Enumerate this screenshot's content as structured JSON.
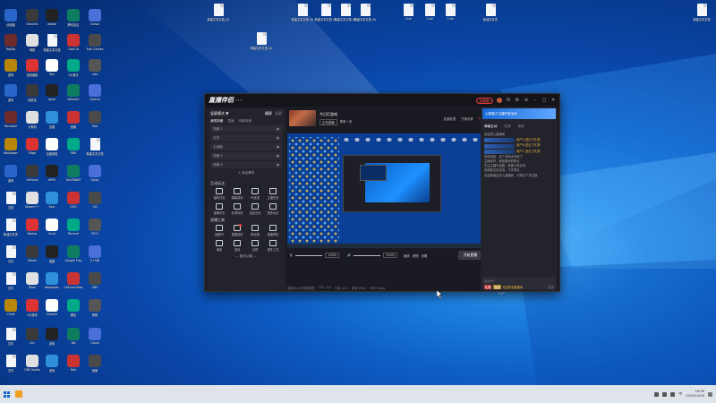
{
  "desktop": {
    "top_files": [
      {
        "label": "新建文本文档 (2)"
      },
      {
        "label": "新建文本文档 (4)"
      },
      {
        "label": "新建文本文档 (3)"
      },
      {
        "label": "新建文本文档 (6)"
      },
      {
        "label": "新建文本文档 (5)"
      },
      {
        "label": "1.txt"
      },
      {
        "label": "1.txt"
      },
      {
        "label": "1.txt"
      },
      {
        "label": "新建文件夹"
      },
      {
        "label": "新建文本文档"
      },
      {
        "label": "新建文本文档 (4)"
      }
    ],
    "left_icons": [
      {
        "label": "此电脑"
      },
      {
        "label": "Genshin"
      },
      {
        "label": "Adobe"
      },
      {
        "label": "腾讯会议"
      },
      {
        "label": "Cursor"
      },
      {
        "label": "TapTap"
      },
      {
        "label": "网络"
      },
      {
        "label": "新建文本文档"
      },
      {
        "label": "CapCut"
      },
      {
        "label": "Epic Games"
      },
      {
        "label": "游戏"
      },
      {
        "label": "控制面板"
      },
      {
        "label": "Key"
      },
      {
        "label": "QQ音乐"
      },
      {
        "label": "Lala"
      },
      {
        "label": "游戏"
      },
      {
        "label": "回收站"
      },
      {
        "label": "Apex"
      },
      {
        "label": "Valorant"
      },
      {
        "label": "Garena"
      },
      {
        "label": "Rockstar"
      },
      {
        "label": "计算机"
      },
      {
        "label": "迅雷"
      },
      {
        "label": "音频"
      },
      {
        "label": "Star"
      },
      {
        "label": "Wallpaper"
      },
      {
        "label": "Edge"
      },
      {
        "label": "百度网盘"
      },
      {
        "label": "OBS"
      },
      {
        "label": "新建文本文档"
      },
      {
        "label": "游戏"
      },
      {
        "label": "GeForce"
      },
      {
        "label": "APEX"
      },
      {
        "label": "VALORANT"
      },
      {
        "label": "Uplay"
      },
      {
        "label": "文档"
      },
      {
        "label": "Steam++"
      },
      {
        "label": "Epic"
      },
      {
        "label": "GOG"
      },
      {
        "label": "QQ"
      },
      {
        "label": "新建文件夹"
      },
      {
        "label": "Norton"
      },
      {
        "label": "Hunt"
      },
      {
        "label": "Tencent"
      },
      {
        "label": "PICO"
      },
      {
        "label": "文件"
      },
      {
        "label": "Steam"
      },
      {
        "label": "猫猫"
      },
      {
        "label": "Google Play"
      },
      {
        "label": "G HUB"
      },
      {
        "label": "文件"
      },
      {
        "label": "Xbox"
      },
      {
        "label": "Wallpaper"
      },
      {
        "label": "GeForce Now"
      },
      {
        "label": "OBS"
      },
      {
        "label": "Circle"
      },
      {
        "label": "QQ游戏"
      },
      {
        "label": "Chrome"
      },
      {
        "label": "微信"
      },
      {
        "label": "狗狗"
      },
      {
        "label": "文件"
      },
      {
        "label": "Arc"
      },
      {
        "label": "游戏"
      },
      {
        "label": "Bili"
      },
      {
        "label": "Cloud"
      },
      {
        "label": "文件"
      },
      {
        "label": "OBS Studio"
      },
      {
        "label": "游戏"
      },
      {
        "label": "Mail"
      },
      {
        "label": "相册"
      },
      {
        "label": "Flash"
      }
    ]
  },
  "app": {
    "logo": "直播伴侣",
    "version": "v7.x",
    "headline_pill": "去获取",
    "left_panel": {
      "mode_label": "竖屏模式 ▼",
      "mode_tags": [
        "横屏",
        "竖屏"
      ],
      "tabs": [
        "我的场景",
        "直播",
        "有趣场景"
      ],
      "scenes": [
        "场景 1",
        "文字",
        "主画面",
        "场景 4",
        "场景 5"
      ],
      "add_source": "+ 添加素材",
      "sections": [
        {
          "title": "互动玩法",
          "tools": [
            "福利红包",
            "弹幕游戏",
            "PK连麦",
            "主播任务",
            "直播时长",
            "礼物特效",
            "连麦互动",
            "更多玩法"
          ]
        },
        {
          "title": "直播工具",
          "tools": [
            "话题PK",
            "直播回放",
            "粉丝团",
            "直播预告",
            "美颜",
            "音效",
            "滤镜",
            "更多工具"
          ]
        }
      ],
      "more_fn": "— 更多功能 —"
    },
    "stream_info": {
      "title": "今日打游戏",
      "sub_tags": [
        "正在直播",
        "再来一次"
      ],
      "right_items": [
        "直播数据",
        "开播设置",
        "25"
      ]
    },
    "controls": {
      "mic_pct": "100%",
      "speaker_pct": "100%",
      "labels": [
        "麦克风",
        "扬声器",
        "画质",
        "滤镜",
        "设置"
      ],
      "go_live": "开始直播"
    },
    "status": [
      "直播间1小时直播数据",
      "CPU 13%",
      "内存 41%",
      "网速 0KB/s",
      "码率 0kbps"
    ],
    "right_panel": {
      "banner": "心跳魔力主播夺宝活动",
      "tabs": [
        "弹幕互动",
        "礼物",
        "贵宾"
      ],
      "messages": [
        "欢迎进入直播间",
        "用户A 送出了礼物",
        "用户B 送出了礼物",
        "用户C 送出了礼物",
        "哈哈哈哈，这个游戏太好玩了",
        "主播你好，我是新来的粉丝",
        "关注主播不迷路，感谢大家支持",
        "感谢各位的支持，下次再见",
        "欢迎新朋友进入直播间，记得点个关注哦"
      ],
      "input_placeholder": "说点什么",
      "input_badges": [
        "礼物",
        "福袋",
        "欢迎来到直播间",
        "发送"
      ]
    }
  },
  "taskbar": {
    "time": "18:56",
    "date": "2025/10/26",
    "lang": "中"
  }
}
